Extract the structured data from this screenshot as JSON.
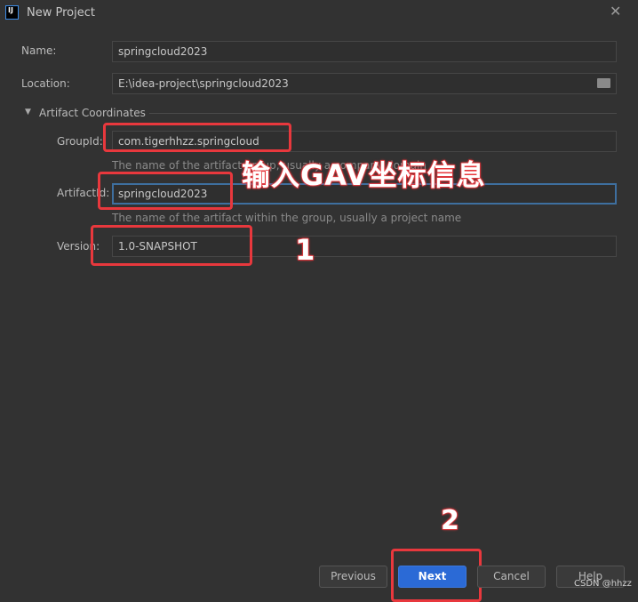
{
  "window": {
    "title": "New Project",
    "logo": "IJ"
  },
  "form": {
    "name_label": "Name:",
    "name_value": "springcloud2023",
    "location_label": "Location:",
    "location_value": "E:\\idea-project\\springcloud2023",
    "section_title": "Artifact Coordinates",
    "groupid_label": "GroupId:",
    "groupid_value": "com.tigerhhzz.springcloud",
    "groupid_hint": "The name of the artifact group, usually a company domain",
    "artifactid_label": "ArtifactId:",
    "artifactid_value": "springcloud2023",
    "artifactid_hint": "The name of the artifact within the group, usually a project name",
    "version_label": "Version:",
    "version_value": "1.0-SNAPSHOT"
  },
  "buttons": {
    "previous": "Previous",
    "next": "Next",
    "cancel": "Cancel",
    "help": "Help"
  },
  "annotations": {
    "main": "输入GAV坐标信息",
    "step1": "1",
    "step2": "2"
  },
  "watermark": "CSDN @hhzz",
  "colors": {
    "accent": "#2b6ad6",
    "annotation": "#e8383d"
  }
}
